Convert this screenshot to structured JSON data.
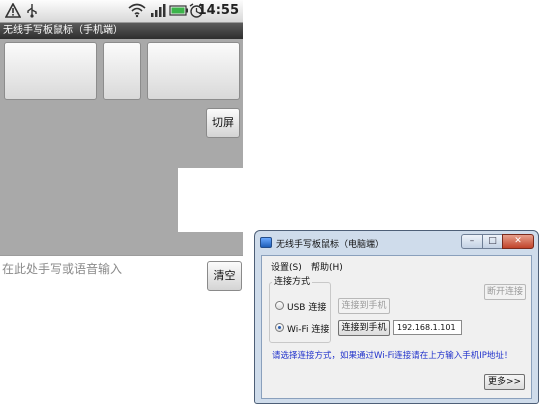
{
  "phone": {
    "status_bar": {
      "time": "14:55",
      "icons": [
        "warning-icon",
        "usb-icon",
        "wifi-icon",
        "signal-icon",
        "battery-icon",
        "alarm-icon"
      ]
    },
    "app_title": "无线手写板鼠标（手机端）",
    "switch_screen_button": "切屏",
    "handwriting_input": {
      "placeholder": "在此处手写或语音输入"
    },
    "clear_button": "清空",
    "colors": {
      "touch_area": "#a9a9a9",
      "title_bar": "#3a3a3a"
    }
  },
  "pc_window": {
    "title": "无线手写板鼠标（电脑端）",
    "menu": [
      {
        "label": "设置(S)"
      },
      {
        "label": "帮助(H)"
      }
    ],
    "connection_group": {
      "label": "连接方式",
      "options": [
        {
          "label": "USB 连接",
          "checked": false,
          "connect_button": "连接到手机",
          "connect_enabled": false
        },
        {
          "label": "Wi-Fi 连接",
          "checked": true,
          "connect_button": "连接到手机",
          "connect_enabled": true
        }
      ]
    },
    "ip_address": "192.168.1.101",
    "disconnect_button": "断开连接",
    "hint": "请选择连接方式，如果通过Wi-Fi连接请在上方输入手机IP地址！",
    "more_button": "更多>>",
    "colors": {
      "frame": "#cfdceb",
      "hint_text": "#2233cc",
      "close_button": "#c0432a"
    }
  }
}
